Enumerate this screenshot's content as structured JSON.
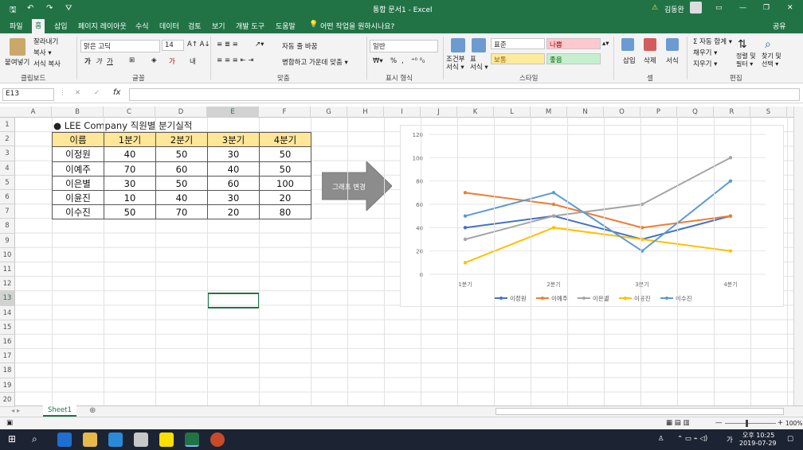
{
  "titlebar": {
    "title": "통합 문서1  -  Excel",
    "warning": "⚠",
    "user": "김동완"
  },
  "tabs": [
    "파일",
    "홈",
    "삽입",
    "페이지 레이아웃",
    "수식",
    "데이터",
    "검토",
    "보기",
    "개발 도구",
    "도움말"
  ],
  "tell_me": "어떤 작업을 원하시나요?",
  "share": "공유",
  "ribbon": {
    "paste": "붙여넣기",
    "cut": "잘라내기",
    "copy": "복사 ▾",
    "format_painter": "서식 복사",
    "font": "맑은 고딕",
    "size": "14",
    "bold": "가",
    "italic": "가",
    "underline": "가",
    "wrap": "자동 줄 바꿈",
    "merge": "병합하고 가운데 맞춤 ▾",
    "number_format": "일반",
    "percent": "%",
    "comma": ",",
    "cond": "조건부\n서식 ▾",
    "table": "표\n서식 ▾",
    "style_normal": "표준",
    "style_bad": "나쁨",
    "style_neutral": "보통",
    "style_good": "좋음",
    "insert": "삽입",
    "delete": "삭제",
    "format": "서식",
    "autosum": "Σ 자동 합계 ▾",
    "fill": "채우기 ▾",
    "clear": "지우기 ▾",
    "sort": "정렬 및\n필터 ▾",
    "find": "찾기 및\n선택 ▾"
  },
  "groups": {
    "clipboard": "클립보드",
    "font": "글꼴",
    "align": "맞춤",
    "number": "표시 형식",
    "styles": "스타일",
    "cells": "셀",
    "edit": "편집"
  },
  "namebox": "E13",
  "fx": "fx",
  "columns": [
    "A",
    "B",
    "C",
    "D",
    "E",
    "F",
    "G",
    "H",
    "I",
    "J",
    "K",
    "L",
    "M",
    "N",
    "O",
    "P",
    "Q",
    "R",
    "S"
  ],
  "rows": [
    "1",
    "2",
    "3",
    "4",
    "5",
    "6",
    "7",
    "8",
    "9",
    "10",
    "11",
    "12",
    "13",
    "14",
    "15",
    "16",
    "17",
    "18",
    "19",
    "20"
  ],
  "sheet_title": "● LEE Company 직원별 분기실적",
  "table": {
    "headers": [
      "이름",
      "1분기",
      "2분기",
      "3분기",
      "4분기"
    ],
    "rows": [
      [
        "이정원",
        "40",
        "50",
        "30",
        "50"
      ],
      [
        "이예주",
        "70",
        "60",
        "40",
        "50"
      ],
      [
        "이은별",
        "30",
        "50",
        "60",
        "100"
      ],
      [
        "이윤진",
        "10",
        "40",
        "30",
        "20"
      ],
      [
        "이수진",
        "50",
        "70",
        "20",
        "80"
      ]
    ]
  },
  "arrow_label": "그래프 변경",
  "chart_data": {
    "type": "line",
    "categories": [
      "1분기",
      "2분기",
      "3분기",
      "4분기"
    ],
    "ylim": [
      0,
      120
    ],
    "yticks": [
      "0",
      "20",
      "40",
      "60",
      "80",
      "100",
      "120"
    ],
    "series": [
      {
        "name": "이정원",
        "values": [
          40,
          50,
          30,
          50
        ],
        "color": "#4472c4"
      },
      {
        "name": "이예주",
        "values": [
          70,
          60,
          40,
          50
        ],
        "color": "#ed7d31"
      },
      {
        "name": "이은별",
        "values": [
          30,
          50,
          60,
          100
        ],
        "color": "#a5a5a5"
      },
      {
        "name": "이윤진",
        "values": [
          10,
          40,
          30,
          20
        ],
        "color": "#ffc000"
      },
      {
        "name": "이수진",
        "values": [
          50,
          70,
          20,
          80
        ],
        "color": "#5b9bd5"
      }
    ],
    "legend": "bottom",
    "grid": true
  },
  "sheet_tab": "Sheet1",
  "zoom": "100%",
  "clock": {
    "time": "오후 10:25",
    "date": "2019-07-29"
  },
  "ime": "가",
  "accent": "#217346"
}
